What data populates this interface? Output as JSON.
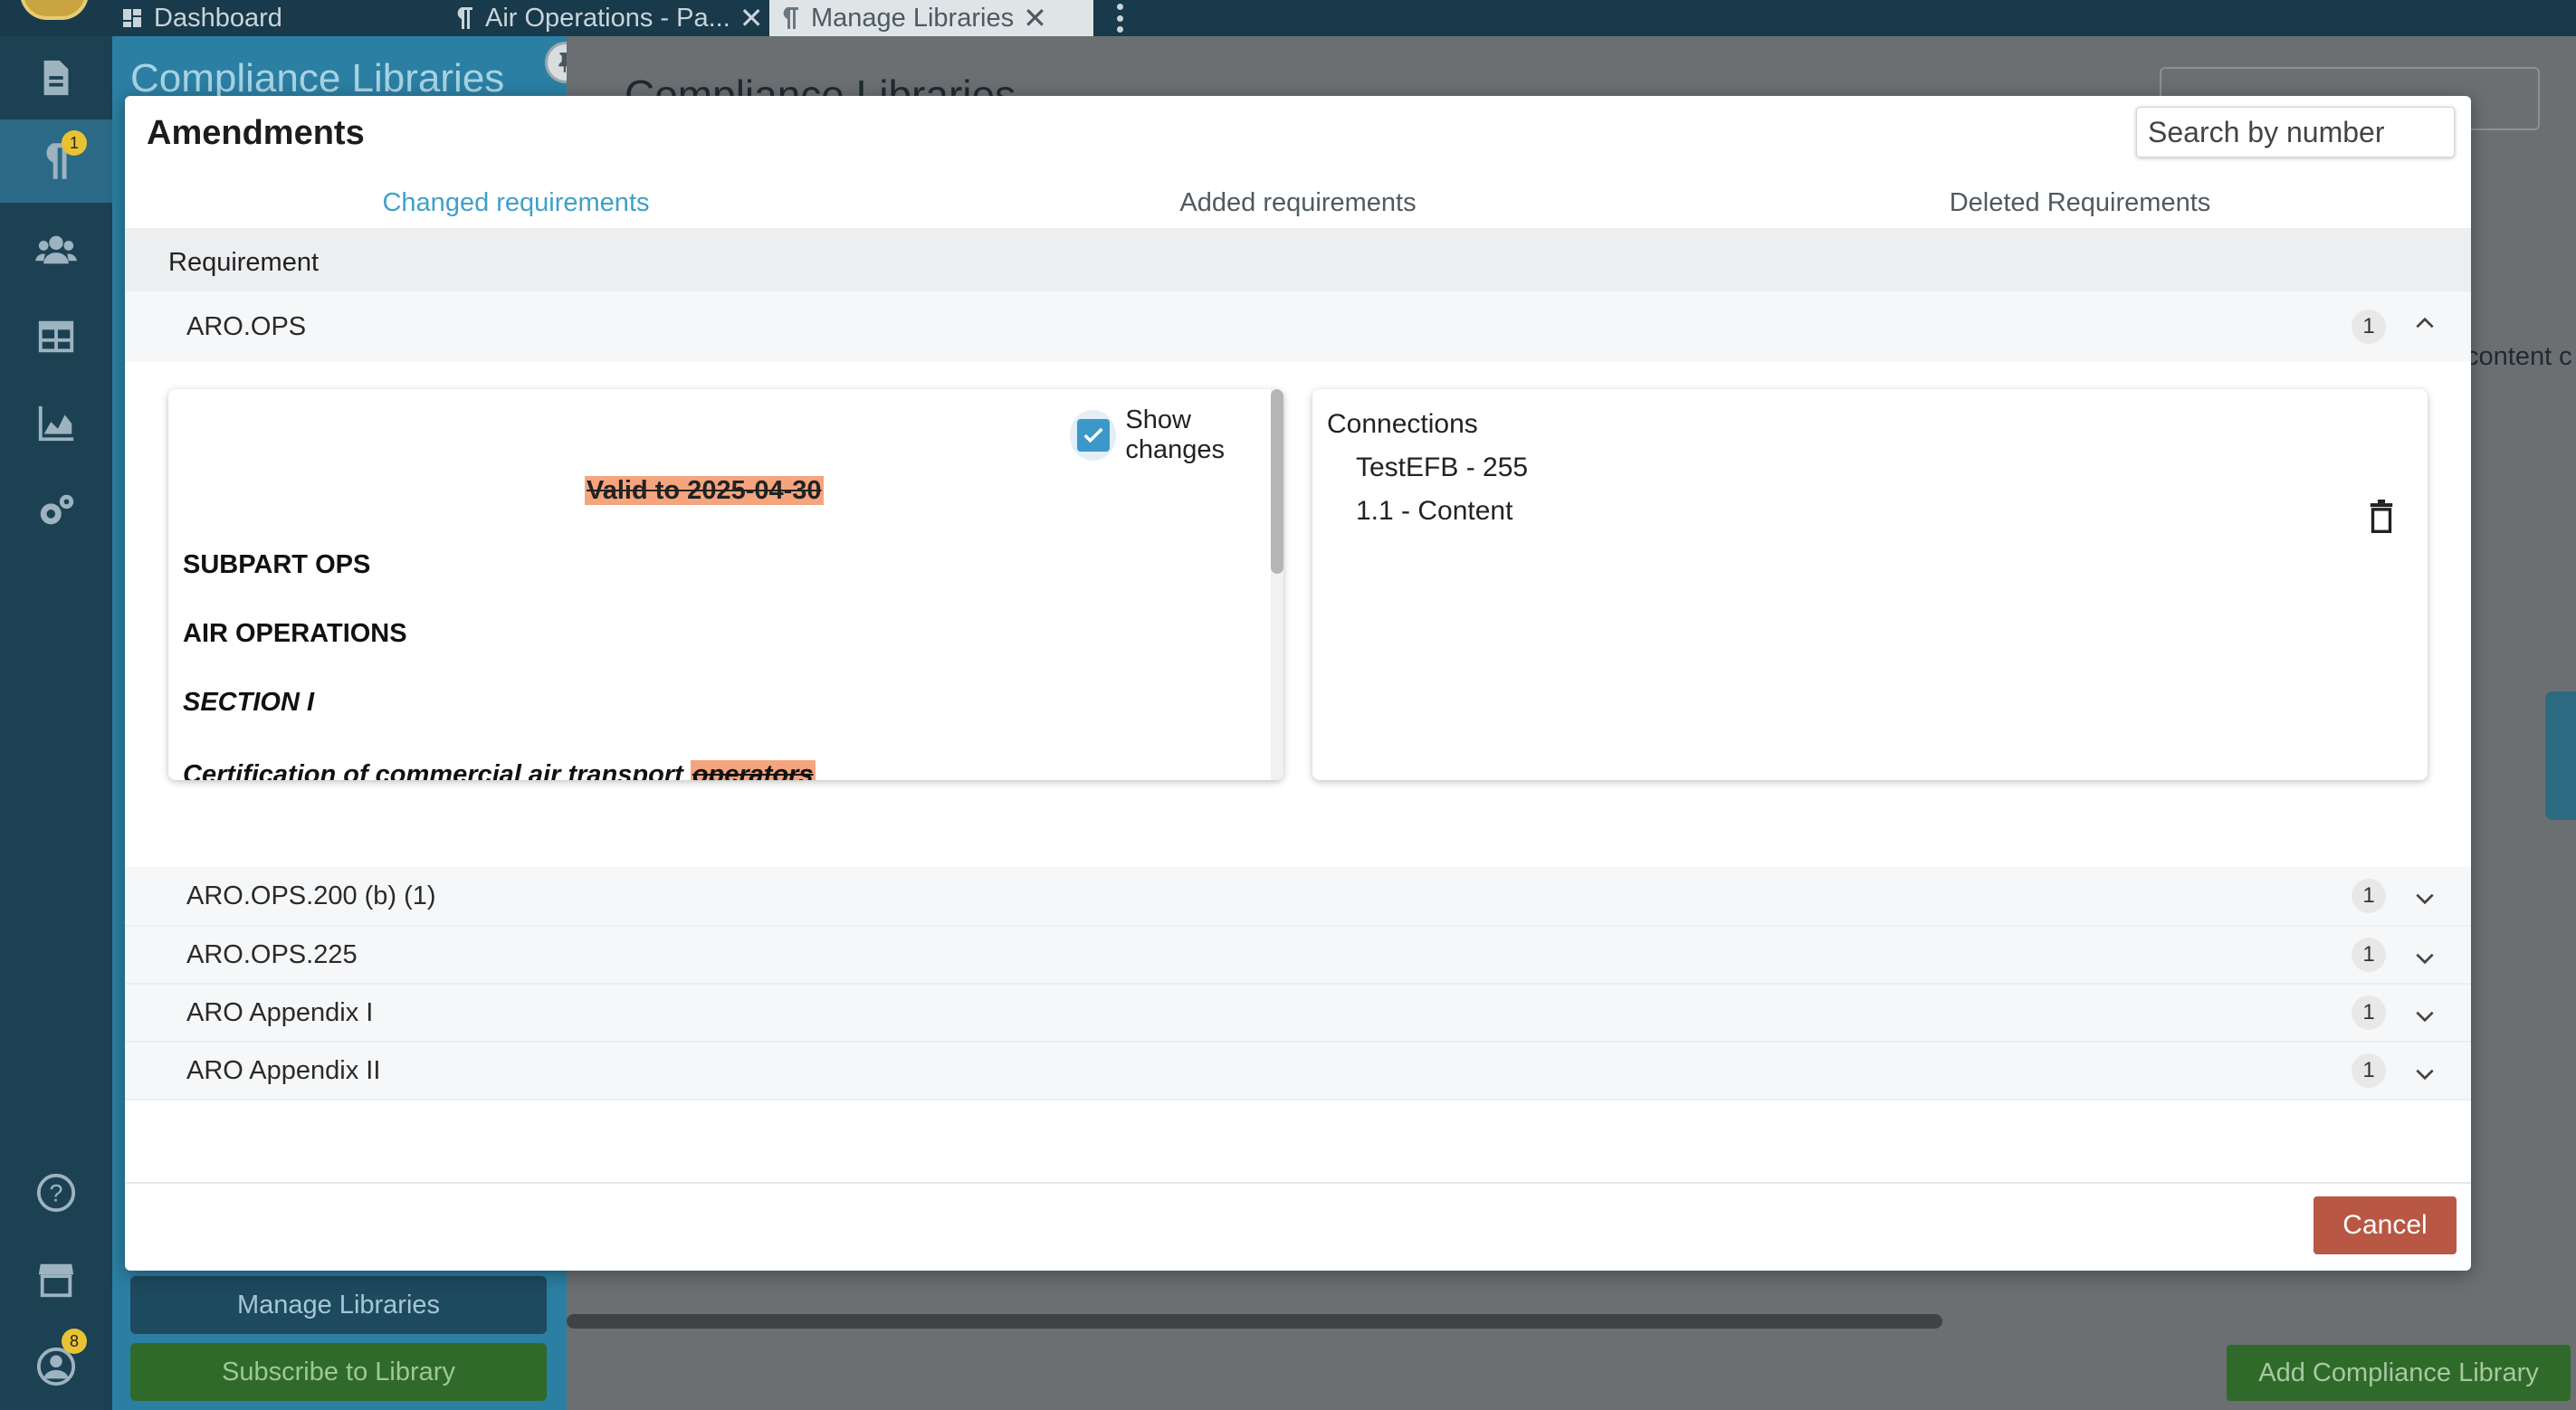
{
  "topbar": {
    "tabs": [
      {
        "label": "Dashboard",
        "icon": "dashboard-icon"
      },
      {
        "label": "Air Operations - Pa...",
        "icon": "paragraph-icon",
        "closable": true
      },
      {
        "label": "Manage Libraries",
        "icon": "paragraph-icon",
        "closable": true,
        "active": true
      }
    ]
  },
  "rail": {
    "items": [
      "document-icon",
      "paragraph-icon",
      "users-icon",
      "table-icon",
      "chart-icon",
      "settings-icon",
      "help-icon",
      "store-icon",
      "account-icon"
    ],
    "paragraph_badge": "1",
    "account_badge": "8"
  },
  "panel": {
    "title": "Compliance Libraries",
    "manage_label": "Manage Libraries",
    "subscribe_label": "Subscribe to Library"
  },
  "background": {
    "heading": "Compliance Libraries",
    "content_snippet": "content c",
    "add_label": "Add Compliance Library"
  },
  "modal": {
    "title": "Amendments",
    "search_placeholder": "Search by number",
    "tabs": [
      "Changed requirements",
      "Added requirements",
      "Deleted Requirements"
    ],
    "active_tab": 0,
    "table_header": "Requirement",
    "rows": [
      {
        "label": "ARO.OPS",
        "count": "1",
        "expanded": true
      },
      {
        "label": "ARO.OPS.200 (b) (1)",
        "count": "1"
      },
      {
        "label": "ARO.OPS.225",
        "count": "1"
      },
      {
        "label": "ARO Appendix I",
        "count": "1"
      },
      {
        "label": "ARO Appendix II",
        "count": "1"
      }
    ],
    "detail": {
      "show_changes_label": "Show changes",
      "show_changes_checked": true,
      "valid_to": "Valid to 2025-04-30",
      "lines": [
        "SUBPART OPS",
        "AIR OPERATIONS",
        "SECTION I"
      ],
      "cert_text": "Certification of commercial air transport",
      "cert_removed": "operators"
    },
    "connections": {
      "title": "Connections",
      "items": [
        "TestEFB - 255",
        "1.1 - Content"
      ]
    },
    "cancel_label": "Cancel",
    "accent_color": "#3fa0c9",
    "highlight_color": "#f5a57e",
    "cancel_color": "#b95745"
  }
}
